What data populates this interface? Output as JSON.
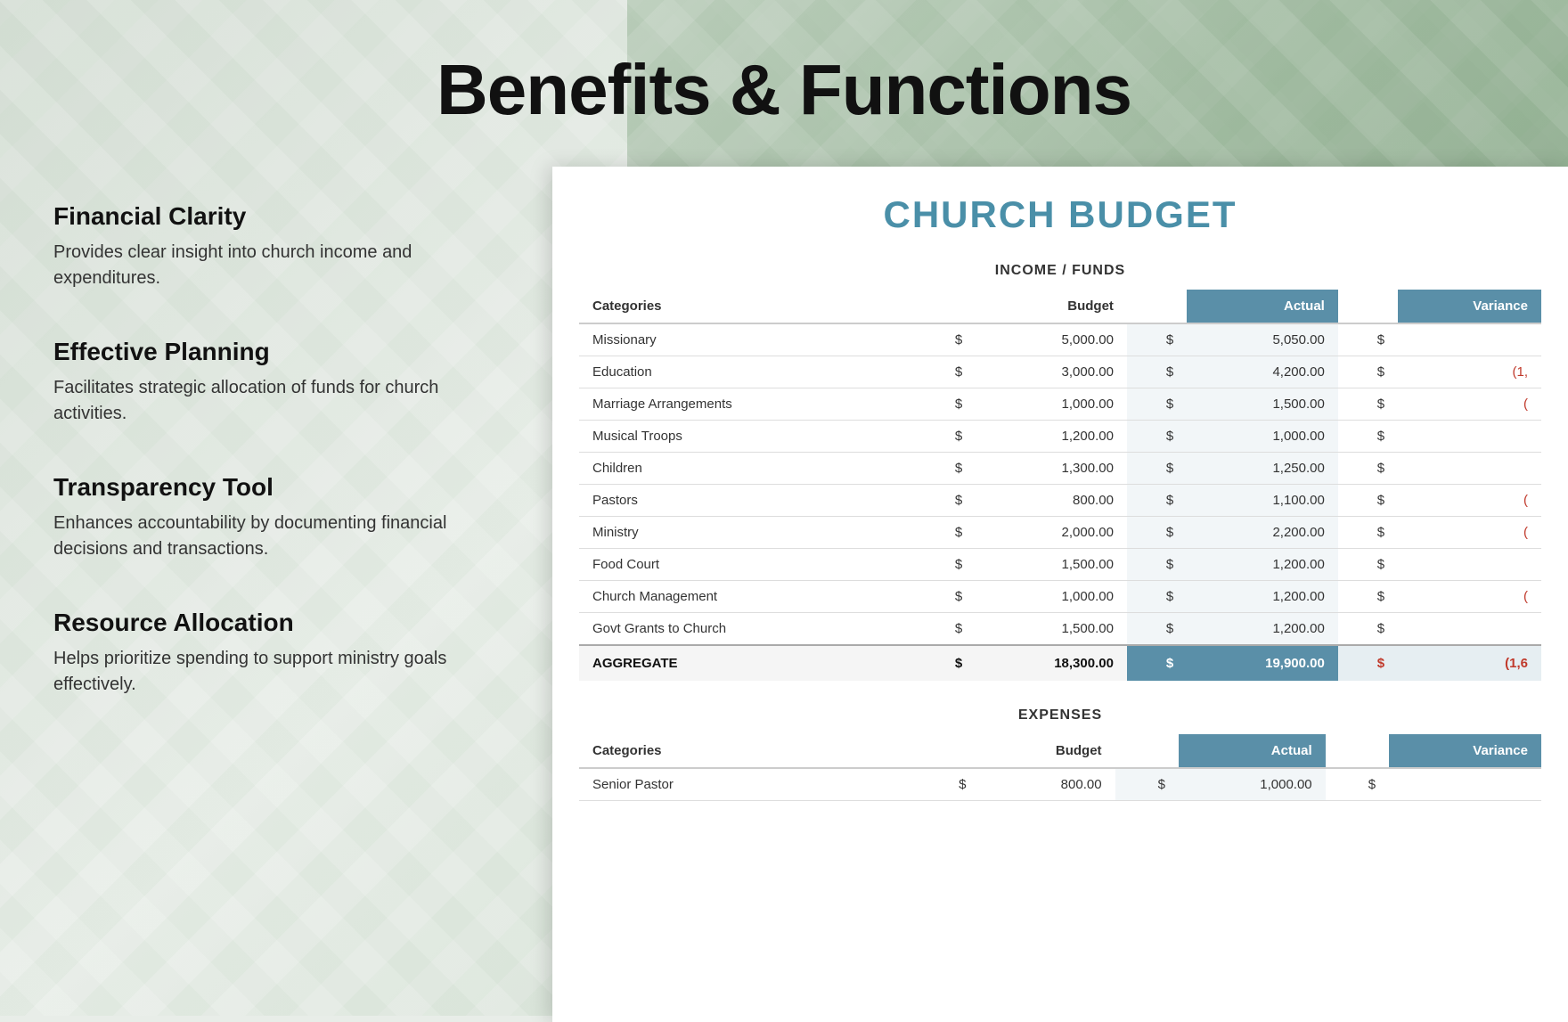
{
  "page": {
    "title": "Benefits & Functions"
  },
  "benefits": [
    {
      "id": "financial-clarity",
      "title": "Financial Clarity",
      "description": "Provides clear insight into church income and expenditures."
    },
    {
      "id": "effective-planning",
      "title": "Effective Planning",
      "description": "Facilitates strategic allocation of funds for church activities."
    },
    {
      "id": "transparency-tool",
      "title": "Transparency Tool",
      "description": "Enhances accountability by documenting financial decisions and transactions."
    },
    {
      "id": "resource-allocation",
      "title": "Resource Allocation",
      "description": "Helps prioritize spending to support ministry goals effectively."
    }
  ],
  "spreadsheet": {
    "title": "CHURCH BUDGET",
    "income": {
      "section_title": "INCOME / FUNDS",
      "columns": {
        "categories": "Categories",
        "budget": "Budget",
        "actual": "Actual",
        "variance": "Variance"
      },
      "rows": [
        {
          "category": "Missionary",
          "budget": "5,000.00",
          "actual": "5,050.00",
          "variance": "",
          "variance_type": "positive"
        },
        {
          "category": "Education",
          "budget": "3,000.00",
          "actual": "4,200.00",
          "variance": "(1,",
          "variance_type": "negative"
        },
        {
          "category": "Marriage Arrangements",
          "budget": "1,000.00",
          "actual": "1,500.00",
          "variance": "(",
          "variance_type": "negative"
        },
        {
          "category": "Musical Troops",
          "budget": "1,200.00",
          "actual": "1,000.00",
          "variance": "",
          "variance_type": "positive"
        },
        {
          "category": "Children",
          "budget": "1,300.00",
          "actual": "1,250.00",
          "variance": "",
          "variance_type": "positive"
        },
        {
          "category": "Pastors",
          "budget": "800.00",
          "actual": "1,100.00",
          "variance": "(",
          "variance_type": "negative"
        },
        {
          "category": "Ministry",
          "budget": "2,000.00",
          "actual": "2,200.00",
          "variance": "(",
          "variance_type": "negative"
        },
        {
          "category": "Food Court",
          "budget": "1,500.00",
          "actual": "1,200.00",
          "variance": "",
          "variance_type": "positive"
        },
        {
          "category": "Church Management",
          "budget": "1,000.00",
          "actual": "1,200.00",
          "variance": "(",
          "variance_type": "negative"
        },
        {
          "category": "Govt Grants to Church",
          "budget": "1,500.00",
          "actual": "1,200.00",
          "variance": "",
          "variance_type": "positive"
        }
      ],
      "aggregate": {
        "label": "AGGREGATE",
        "budget": "18,300.00",
        "actual": "19,900.00",
        "variance": "(1,6",
        "variance_type": "negative"
      }
    },
    "expenses": {
      "section_title": "EXPENSES",
      "columns": {
        "categories": "Categories",
        "budget": "Budget",
        "actual": "Actual",
        "variance": "Variance"
      },
      "rows": [
        {
          "category": "Senior Pastor",
          "budget": "800.00",
          "actual": "1,000.00",
          "variance": "",
          "variance_type": "negative"
        }
      ]
    }
  }
}
